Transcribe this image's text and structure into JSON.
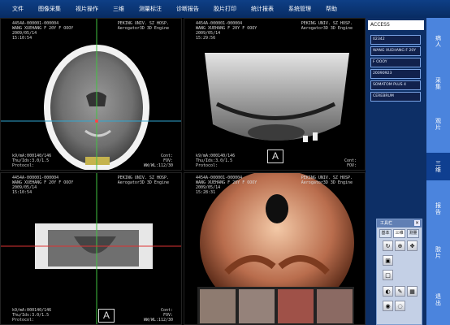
{
  "menu": [
    "文件",
    "图像采集",
    "视片操作",
    "三维",
    "测量标注",
    "诊断报告",
    "胶片打印",
    "统计报表",
    "系统管理",
    "帮助"
  ],
  "viewports": [
    {
      "overlay_tl": "4454A-000001-000004\nWANG XUEHANG F 20Y F OOOY\n2009/05/14\n15:10:54",
      "overlay_tr": "PEKING UNIV. SZ HOSP.\nAerogator3D 3D Engine",
      "overlay_bl": "k9/mA:000140/146\nThu/Ids:3.0/1.5\nProtocol:",
      "overlay_br": "Cont:\nFOV:\nWW/WL:112/30"
    },
    {
      "overlay_tl": "4454A-000001-000004\nWANG XUEHANG F 20Y F OOOY\n2009/05/14\n15:29:56",
      "overlay_tr": "PEKING UNIV. SZ HOSP.\nAerogator3D 3D Engine",
      "overlay_bl": "k9/mA:000140/146\nThu/Ids:3.0/1.5\nProtocol:",
      "overlay_br": "Cont:\nFOV:",
      "badge": "A"
    },
    {
      "overlay_tl": "4454A-000001-000004\nWANG XUEHANG F 20Y F OOOY\n2009/05/14\n15:10:54",
      "overlay_tr": "PEKING UNIV. SZ HOSP.\nAerogator3D 3D Engine",
      "overlay_bl": "k9/mA:000140/146\nThu/Ids:3.0/1.5\nProtocol:",
      "overlay_br": "Cont:\nFOV:\nWW/WL:112/30",
      "badge": "A"
    },
    {
      "overlay_tl": "4454A-000001-000004\nWANG XUEHANG F 20Y F OOOY\n2009/05/14\n15:28:31",
      "overlay_tr": "PEKING UNIV. SZ HOSP.\nAerogator3D 3D Engine"
    }
  ],
  "sidebar": {
    "top_box": "ACCESS",
    "info": [
      "02342",
      "WANG XUEHANG F 20Y",
      "F OOOY",
      "20090923",
      "SOMATOM PLUS 4",
      "CEREBRUM"
    ],
    "tool_panel": {
      "title": "工具栏",
      "close": "×",
      "tabs": [
        "基本",
        "三维",
        "测量"
      ]
    }
  },
  "rightnav": [
    "病人",
    "采集",
    "观片",
    "三维",
    "报告",
    "胶片",
    "退出"
  ]
}
